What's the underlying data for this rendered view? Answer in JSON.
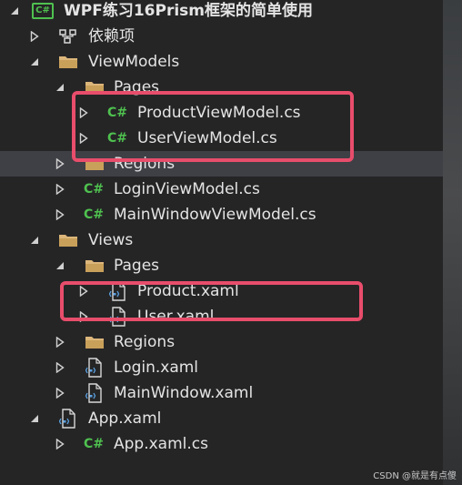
{
  "project": {
    "icon": "csharp-project-icon",
    "icon_text": "C#",
    "title": "WPF练习16Prism框架的简单使用"
  },
  "items": [
    {
      "label": "依赖项",
      "icon": "dependencies-icon"
    },
    {
      "label": "ViewModels",
      "icon": "folder-icon"
    },
    {
      "label": "Pages",
      "icon": "folder-icon"
    },
    {
      "label": "ProductViewModel.cs",
      "icon": "csharp-file-icon",
      "icon_text": "C#"
    },
    {
      "label": "UserViewModel.cs",
      "icon": "csharp-file-icon",
      "icon_text": "C#"
    },
    {
      "label": "Regions",
      "icon": "folder-icon"
    },
    {
      "label": "LoginViewModel.cs",
      "icon": "csharp-file-icon",
      "icon_text": "C#"
    },
    {
      "label": "MainWindowViewModel.cs",
      "icon": "csharp-file-icon",
      "icon_text": "C#"
    },
    {
      "label": "Views",
      "icon": "folder-icon"
    },
    {
      "label": "Pages",
      "icon": "folder-icon"
    },
    {
      "label": "Product.xaml",
      "icon": "xaml-file-icon"
    },
    {
      "label": "User.xaml",
      "icon": "xaml-file-icon"
    },
    {
      "label": "Regions",
      "icon": "folder-icon"
    },
    {
      "label": "Login.xaml",
      "icon": "xaml-file-icon"
    },
    {
      "label": "MainWindow.xaml",
      "icon": "xaml-file-icon"
    },
    {
      "label": "App.xaml",
      "icon": "xaml-file-icon"
    },
    {
      "label": "App.xaml.cs",
      "icon": "csharp-file-icon",
      "icon_text": "C#"
    }
  ],
  "watermark": "CSDN @就是有点傻",
  "colors": {
    "background": "#252526",
    "highlight_box": "#e84d6b",
    "csharp_green": "#4fc14f",
    "folder": "#dcb67a"
  }
}
